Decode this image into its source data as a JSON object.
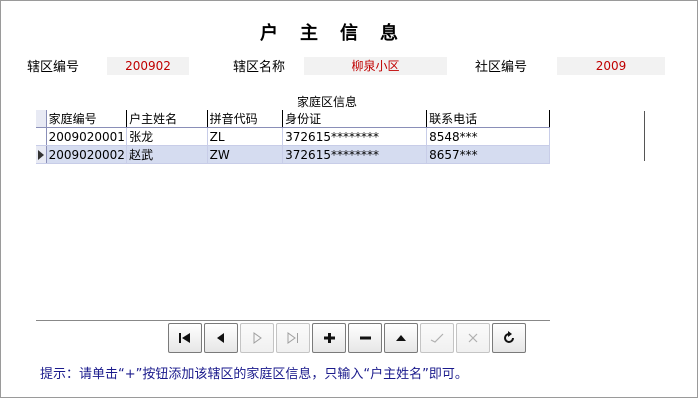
{
  "title": "户主信息",
  "fields": {
    "district_code_label": "辖区编号",
    "district_code_value": "200902",
    "district_name_label": "辖区名称",
    "district_name_value": "柳泉小区",
    "community_code_label": "社区编号",
    "community_code_value": "2009"
  },
  "grid": {
    "title": "家庭区信息",
    "columns": [
      "家庭编号",
      "户主姓名",
      "拼音代码",
      "身份证",
      "联系电话"
    ],
    "rows": [
      [
        "2009020001",
        "张龙",
        "ZL",
        "372615********",
        "8548***"
      ],
      [
        "2009020002",
        "赵武",
        "ZW",
        "372615********",
        "8657***"
      ]
    ]
  },
  "toolbar": {
    "buttons": [
      {
        "name": "first-record-button",
        "icon": "first-icon",
        "enabled": true
      },
      {
        "name": "previous-record-button",
        "icon": "prev-icon",
        "enabled": true
      },
      {
        "name": "next-record-button",
        "icon": "next-icon",
        "enabled": false
      },
      {
        "name": "last-record-button",
        "icon": "last-icon",
        "enabled": false
      },
      {
        "name": "add-record-button",
        "icon": "plus-icon",
        "enabled": true
      },
      {
        "name": "delete-record-button",
        "icon": "minus-icon",
        "enabled": true
      },
      {
        "name": "edit-record-button",
        "icon": "triangle-up-icon",
        "enabled": true
      },
      {
        "name": "post-edit-button",
        "icon": "check-icon",
        "enabled": false
      },
      {
        "name": "cancel-edit-button",
        "icon": "x-icon",
        "enabled": false
      },
      {
        "name": "refresh-button",
        "icon": "refresh-icon",
        "enabled": true
      }
    ]
  },
  "hint": "提示：请单击“+”按钮添加该辖区的家庭区信息，只输入“户主姓名”即可。",
  "colors": {
    "value_text": "#c00000",
    "selected_row": "#d5dcf0",
    "hint_text": "#1a1a8c"
  }
}
